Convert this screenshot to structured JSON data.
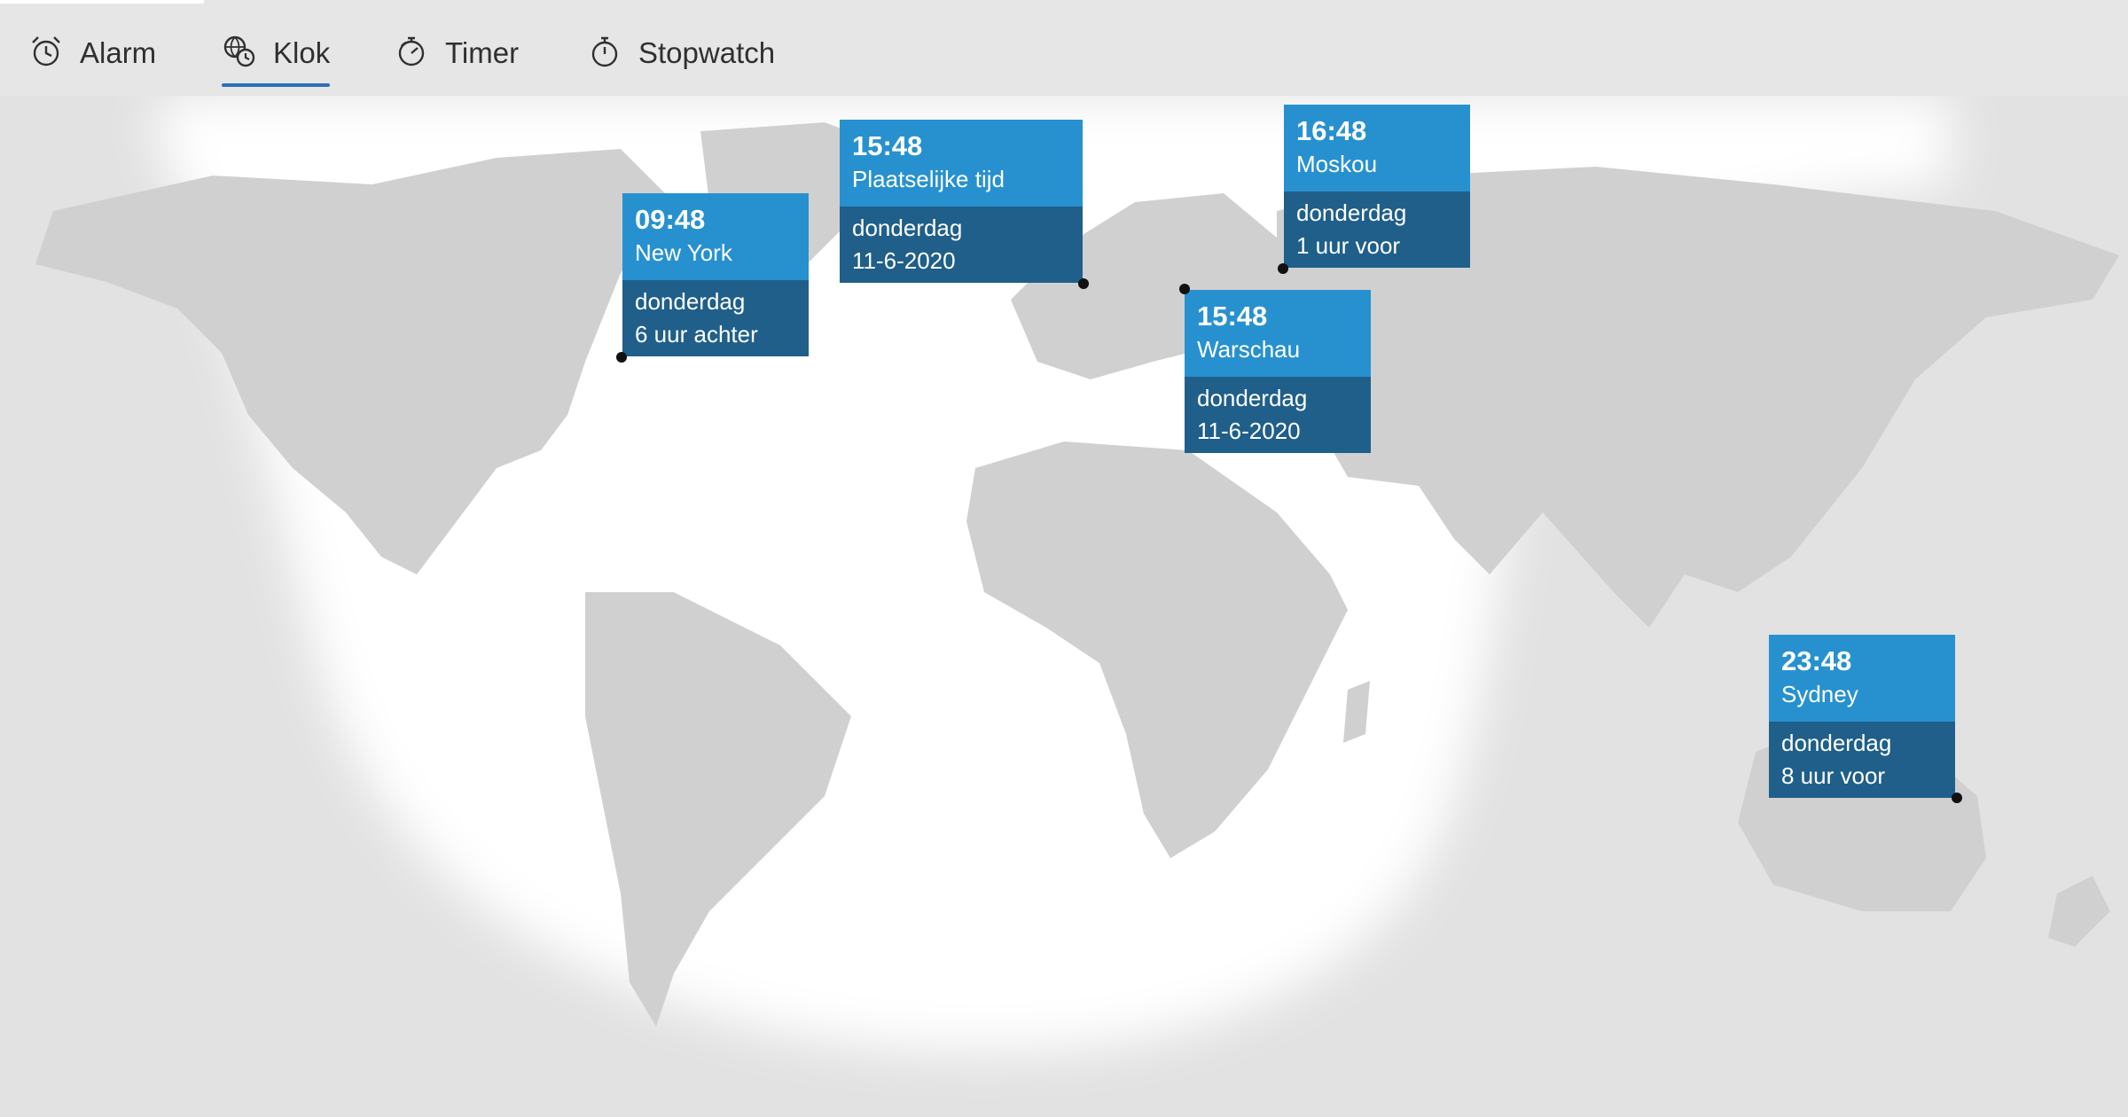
{
  "nav": {
    "tabs": [
      {
        "label": "Alarm",
        "icon": "alarm-clock-icon",
        "selected": false
      },
      {
        "label": "Klok",
        "icon": "world-clock-icon",
        "selected": true
      },
      {
        "label": "Timer",
        "icon": "timer-icon",
        "selected": false
      },
      {
        "label": "Stopwatch",
        "icon": "stopwatch-icon",
        "selected": false
      }
    ]
  },
  "colors": {
    "card_top": "#2791cf",
    "card_bottom": "#1f5f8a",
    "accent_underline": "#2c6fb6",
    "land": "#d0d0d0",
    "night": "#e2e2e2",
    "day": "#ffffff"
  },
  "clocks": [
    {
      "time": "09:48",
      "city": "New York",
      "line1": "donderdag",
      "line2": "6 uur achter"
    },
    {
      "time": "15:48",
      "city": "Plaatselijke tijd",
      "line1": "donderdag",
      "line2": "11-6-2020"
    },
    {
      "time": "16:48",
      "city": "Moskou",
      "line1": "donderdag",
      "line2": "1 uur voor"
    },
    {
      "time": "15:48",
      "city": "Warschau",
      "line1": "donderdag",
      "line2": "11-6-2020"
    },
    {
      "time": "23:48",
      "city": "Sydney",
      "line1": "donderdag",
      "line2": "8 uur voor"
    }
  ]
}
